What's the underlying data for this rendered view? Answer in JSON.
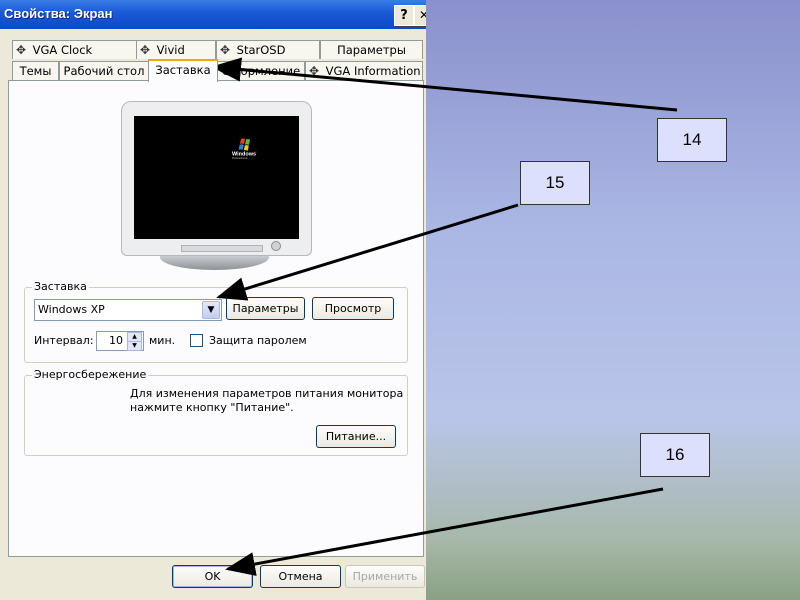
{
  "window": {
    "title": "Свойства: Экран",
    "help_button": "?",
    "close_button": "✕"
  },
  "tabs_row1": [
    {
      "label": "VGA Clock",
      "icon": "vga-clock-icon"
    },
    {
      "label": "Vivid",
      "icon": "vivid-icon"
    },
    {
      "label": "StarOSD",
      "icon": "starosd-icon"
    },
    {
      "label": "Параметры"
    }
  ],
  "tabs_row2": [
    {
      "label": "Темы"
    },
    {
      "label": "Рабочий стол"
    },
    {
      "label": "Заставка",
      "active": true
    },
    {
      "label": "Оформление"
    },
    {
      "label": "VGA Information",
      "icon": "vga-info-icon"
    }
  ],
  "preview": {
    "logo_text": "Windows",
    "logo_sup": "xp",
    "logo_sub": "Professional"
  },
  "screensaver_group": {
    "label": "Заставка",
    "selected": "Windows XP",
    "settings_button": "Параметры",
    "preview_button": "Просмотр",
    "interval_label": "Интервал:",
    "interval_value": "10",
    "interval_unit": "мин.",
    "password_label": "Защита паролем",
    "password_checked": false
  },
  "power_group": {
    "label": "Энергосбережение",
    "description_line1": "Для изменения параметров питания монитора",
    "description_line2": "нажмите кнопку \"Питание\".",
    "power_button": "Питание..."
  },
  "footer": {
    "ok_button": "OK",
    "cancel_button": "Отмена",
    "apply_button": "Применить",
    "apply_enabled": false
  },
  "callouts": [
    {
      "label": "14"
    },
    {
      "label": "15"
    },
    {
      "label": "16"
    }
  ],
  "colors": {
    "title_bar": "#0c48c8",
    "dialog_bg": "#ece9d8",
    "callout_bg": "#dde0fc"
  }
}
